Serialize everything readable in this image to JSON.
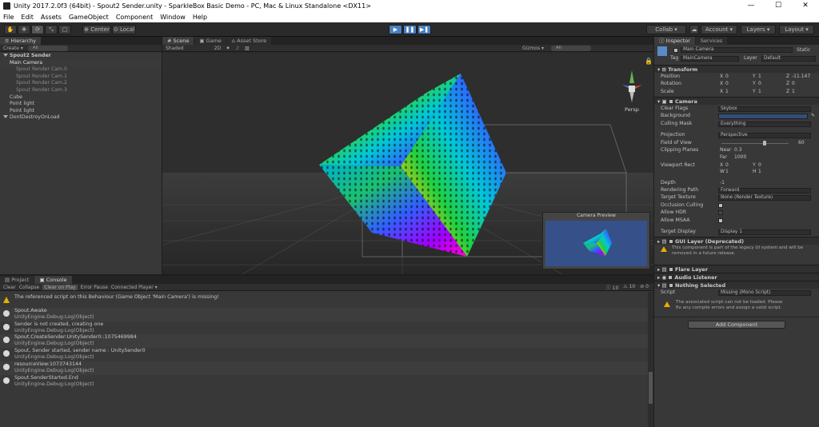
{
  "window": {
    "title": "Unity 2017.2.0f3 (64bit) - Spout2 Sender.unity - SparkleBox Basic Demo - PC, Mac & Linux Standalone <DX11>",
    "controls": [
      "—",
      "☐",
      "✕"
    ]
  },
  "menu": [
    "File",
    "Edit",
    "Assets",
    "GameObject",
    "Component",
    "Window",
    "Help"
  ],
  "toolbar": {
    "center": "Center",
    "local": "Local",
    "collab": "Collab ▾",
    "account": "Account ▾",
    "layers": "Layers",
    "layout": "Layout"
  },
  "hierarchy": {
    "tab": "Hierarchy",
    "create": "Create ▾",
    "search": "All",
    "items": [
      {
        "label": "Spout2 Sender",
        "level": 0,
        "bold": true
      },
      {
        "label": "Main Camera",
        "level": 1,
        "selected": true
      },
      {
        "label": "Spout Render Cam.0",
        "level": 2,
        "dim": true
      },
      {
        "label": "Spout Render Cam.1",
        "level": 2,
        "dim": true
      },
      {
        "label": "Spout Render Cam.2",
        "level": 2,
        "dim": true
      },
      {
        "label": "Spout Render Cam.3",
        "level": 2,
        "dim": true
      },
      {
        "label": "Cube",
        "level": 1
      },
      {
        "label": "Point light",
        "level": 1
      },
      {
        "label": "Point light",
        "level": 1
      },
      {
        "label": "DontDestroyOnLoad",
        "level": 0
      }
    ]
  },
  "scene": {
    "tabs": [
      "Scene",
      "Game",
      "Asset Store"
    ],
    "shaded": "Shaded",
    "mode": "2D",
    "gizmos": "Gizmos ▾",
    "search": "All",
    "persp": "Persp",
    "preview_title": "Camera Preview"
  },
  "inspector": {
    "tabs": [
      "Inspector",
      "Services"
    ],
    "object_name": "Main Camera",
    "static": "Static",
    "tag_label": "Tag",
    "tag": "MainCamera",
    "layer_label": "Layer",
    "layer": "Default",
    "transform": {
      "title": "Transform",
      "position": {
        "label": "Position",
        "x": "0",
        "y": "1",
        "z": "-11.147"
      },
      "rotation": {
        "label": "Rotation",
        "x": "0",
        "y": "0",
        "z": "0"
      },
      "scale": {
        "label": "Scale",
        "x": "1",
        "y": "1",
        "z": "1"
      }
    },
    "camera": {
      "title": "Camera",
      "clear_flags": {
        "label": "Clear Flags",
        "value": "Skybox"
      },
      "background": {
        "label": "Background"
      },
      "culling": {
        "label": "Culling Mask",
        "value": "Everything"
      },
      "projection": {
        "label": "Projection",
        "value": "Perspective"
      },
      "fov": {
        "label": "Field of View",
        "value": "60"
      },
      "clipping": {
        "label": "Clipping Planes",
        "near_label": "Near",
        "near": "0.3",
        "far_label": "Far",
        "far": "1000"
      },
      "viewport": {
        "label": "Viewport Rect",
        "x": "0",
        "y": "0",
        "w": "1",
        "h": "1"
      },
      "depth": {
        "label": "Depth",
        "value": "-1"
      },
      "rendering": {
        "label": "Rendering Path",
        "value": "Forward"
      },
      "target_texture": {
        "label": "Target Texture",
        "value": "None (Render Texture)"
      },
      "occlusion": {
        "label": "Occlusion Culling"
      },
      "hdr": {
        "label": "Allow HDR"
      },
      "msaa": {
        "label": "Allow MSAA"
      },
      "display": {
        "label": "Target Display",
        "value": "Display 1"
      }
    },
    "gui_layer": {
      "title": "GUI Layer (Deprecated)",
      "warning": "This component is part of the legacy UI system and will be removed in a future release."
    },
    "flare_layer": "Flare Layer",
    "audio_listener": "Audio Listener",
    "nothing_selected": {
      "title": "Nothing Selected",
      "script_label": "Script",
      "script": "Missing (Mono Script)",
      "warning": "The associated script can not be loaded. Please fix any compile errors and assign a valid script."
    },
    "add_component": "Add Component"
  },
  "console": {
    "tabs": [
      "Project",
      "Console"
    ],
    "buttons": [
      "Clear",
      "Collapse",
      "Clear on Play",
      "Error Pause",
      "Connected Player ▾"
    ],
    "counts": {
      "log": "10",
      "warn": "10",
      "error": "0"
    },
    "entries": [
      {
        "type": "warn",
        "line1": "The referenced script on this Behaviour (Game Object 'Main Camera') is missing!",
        "line2": ""
      },
      {
        "type": "log",
        "line1": "Spout.Awake",
        "line2": "UnityEngine.Debug:Log(Object)"
      },
      {
        "type": "log",
        "line1": "Sender is not created, creating one",
        "line2": "UnityEngine.Debug:Log(Object)"
      },
      {
        "type": "log",
        "line1": "Spout.CreateSender:UnitySender0::1075469984",
        "line2": "UnityEngine.Debug:Log(Object)"
      },
      {
        "type": "log",
        "line1": "Spout, Sender started, sender name : UnitySender0",
        "line2": "UnityEngine.Debug:Log(Object)"
      },
      {
        "type": "log",
        "line1": "resourceView:1073743144",
        "line2": "UnityEngine.Debug:Log(Object)"
      },
      {
        "type": "log",
        "line1": "Spout.SenderStarted.End",
        "line2": "UnityEngine.Debug:Log(Object)"
      }
    ]
  }
}
